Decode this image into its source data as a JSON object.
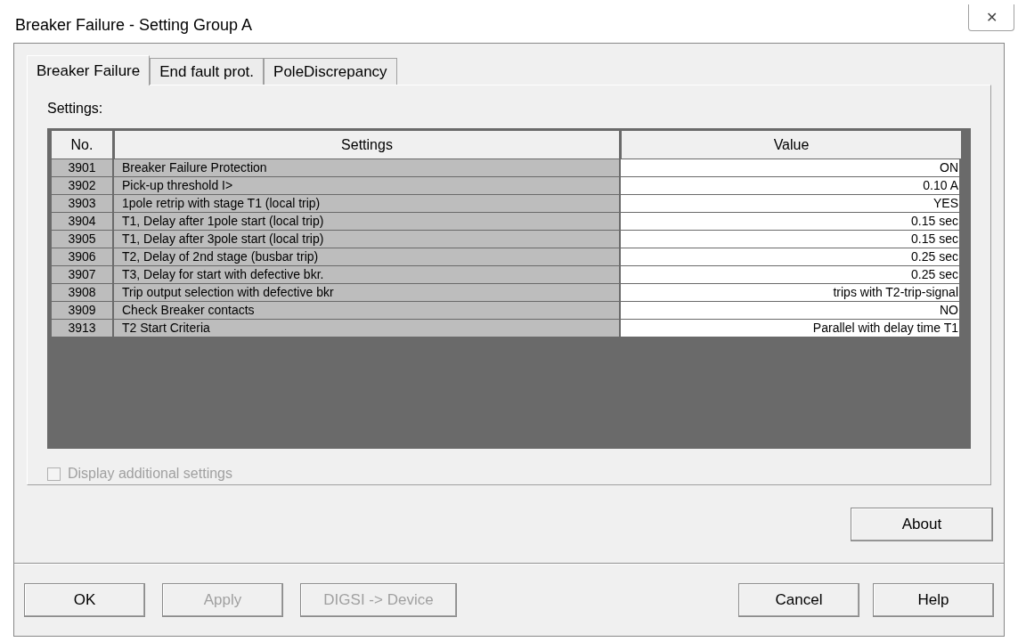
{
  "window": {
    "title": "Breaker Failure - Setting Group A",
    "close": "✕"
  },
  "tabs": [
    {
      "label": "Breaker Failure",
      "selected": true
    },
    {
      "label": "End fault prot.",
      "selected": false
    },
    {
      "label": "PoleDiscrepancy",
      "selected": false
    }
  ],
  "settings_label": "Settings:",
  "table": {
    "columns": [
      "No.",
      "Settings",
      "Value"
    ],
    "rows": [
      {
        "no": "3901",
        "setting": "Breaker Failure Protection",
        "value": "ON"
      },
      {
        "no": "3902",
        "setting": "Pick-up threshold I>",
        "value": "0.10 A"
      },
      {
        "no": "3903",
        "setting": "1pole retrip with stage T1 (local trip)",
        "value": "YES"
      },
      {
        "no": "3904",
        "setting": "T1, Delay after 1pole start (local trip)",
        "value": "0.15 sec"
      },
      {
        "no": "3905",
        "setting": "T1, Delay after 3pole start (local trip)",
        "value": "0.15 sec"
      },
      {
        "no": "3906",
        "setting": "T2, Delay of 2nd stage (busbar trip)",
        "value": "0.25 sec"
      },
      {
        "no": "3907",
        "setting": "T3, Delay for start with defective bkr.",
        "value": "0.25 sec"
      },
      {
        "no": "3908",
        "setting": "Trip output selection with defective bkr",
        "value": "trips with T2-trip-signal"
      },
      {
        "no": "3909",
        "setting": "Check Breaker contacts",
        "value": "NO"
      },
      {
        "no": "3913",
        "setting": "T2 Start Criteria",
        "value": "Parallel with delay time T1"
      }
    ]
  },
  "checkbox": {
    "label": "Display additional settings",
    "checked": false,
    "disabled": true
  },
  "about_button": {
    "label": "About",
    "disabled": false
  },
  "buttons_left": [
    {
      "label": "OK",
      "disabled": false
    },
    {
      "label": "Apply",
      "disabled": true
    },
    {
      "label": "DIGSI -> Device",
      "disabled": true
    }
  ],
  "buttons_right": [
    {
      "label": "Cancel",
      "disabled": false
    },
    {
      "label": "Help",
      "disabled": false
    }
  ]
}
